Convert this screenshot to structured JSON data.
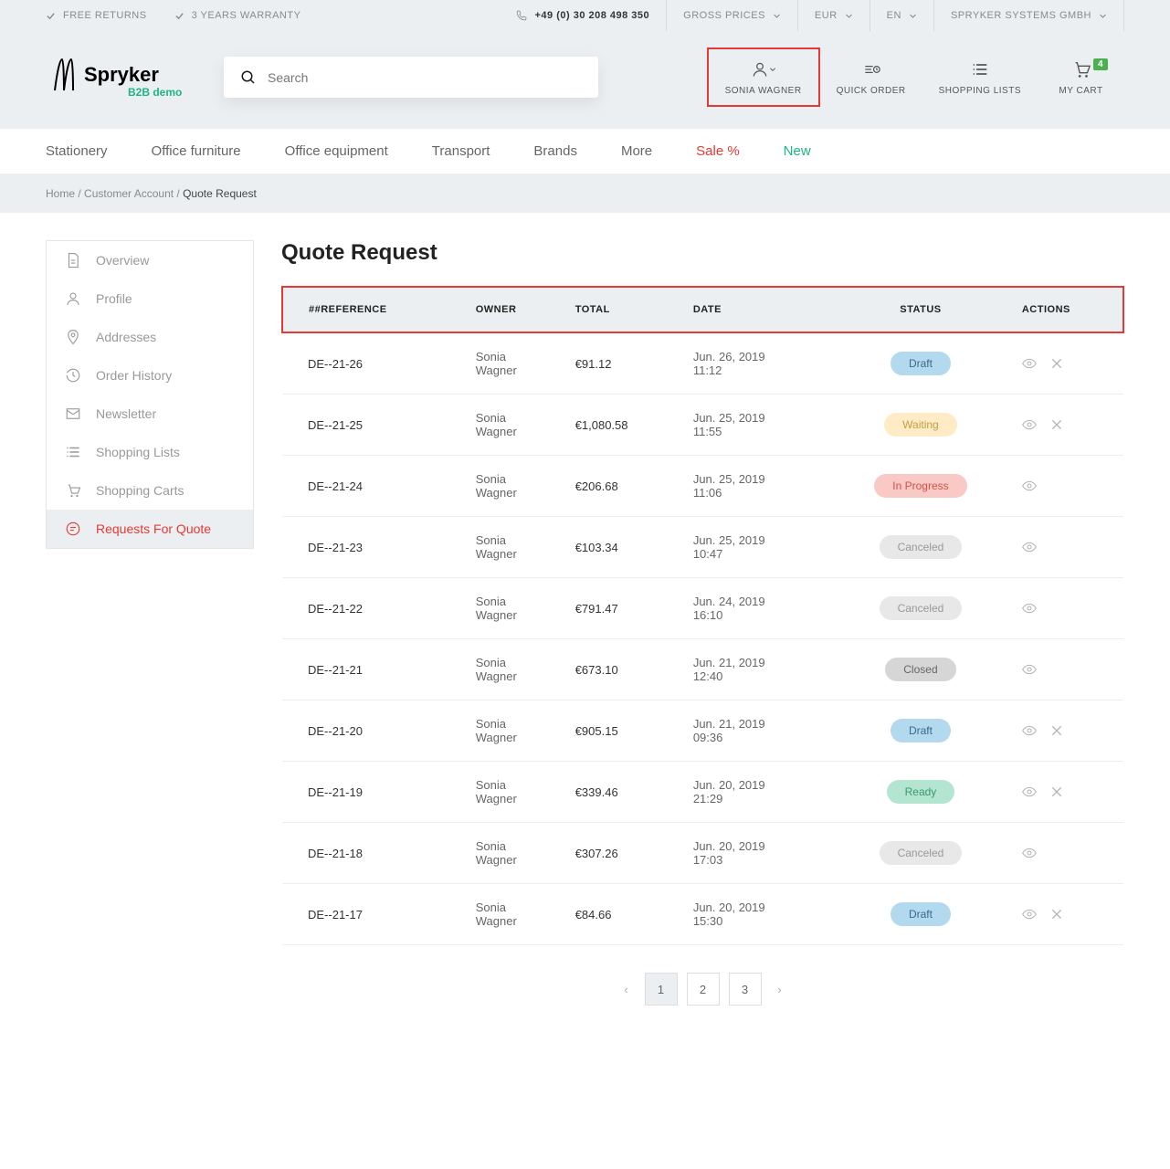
{
  "topbar": {
    "free_returns": "FREE RETURNS",
    "warranty": "3 YEARS WARRANTY",
    "phone": "+49 (0) 30 208 498 350",
    "gross_prices": "GROSS PRICES",
    "currency": "EUR",
    "lang": "EN",
    "company": "SPRYKER SYSTEMS GMBH"
  },
  "search": {
    "placeholder": "Search"
  },
  "header": {
    "user": "SONIA WAGNER",
    "quick_order": "QUICK ORDER",
    "shopping_lists": "SHOPPING LISTS",
    "my_cart": "MY CART",
    "cart_count": "4"
  },
  "nav": {
    "items": [
      {
        "label": "Stationery",
        "class": ""
      },
      {
        "label": "Office furniture",
        "class": ""
      },
      {
        "label": "Office equipment",
        "class": ""
      },
      {
        "label": "Transport",
        "class": ""
      },
      {
        "label": "Brands",
        "class": ""
      },
      {
        "label": "More",
        "class": ""
      },
      {
        "label": "Sale %",
        "class": "sale"
      },
      {
        "label": "New",
        "class": "new"
      }
    ]
  },
  "breadcrumb": {
    "home": "Home",
    "account": "Customer Account",
    "current": "Quote Request"
  },
  "sidebar": {
    "items": [
      {
        "label": "Overview",
        "icon": "doc"
      },
      {
        "label": "Profile",
        "icon": "user"
      },
      {
        "label": "Addresses",
        "icon": "pin"
      },
      {
        "label": "Order History",
        "icon": "history"
      },
      {
        "label": "Newsletter",
        "icon": "mail"
      },
      {
        "label": "Shopping Lists",
        "icon": "list"
      },
      {
        "label": "Shopping Carts",
        "icon": "cart"
      },
      {
        "label": "Requests For Quote",
        "icon": "quote",
        "active": true
      }
    ]
  },
  "page_title": "Quote Request",
  "columns": {
    "ref": "##REFERENCE",
    "owner": "OWNER",
    "total": "TOTAL",
    "date": "DATE",
    "status": "STATUS",
    "actions": "ACTIONS"
  },
  "rows": [
    {
      "ref": "DE--21-26",
      "owner": "Sonia Wagner",
      "total": "€91.12",
      "date": "Jun. 26, 2019 11:12",
      "status": "Draft",
      "status_class": "draft",
      "cancel": true
    },
    {
      "ref": "DE--21-25",
      "owner": "Sonia Wagner",
      "total": "€1,080.58",
      "date": "Jun. 25, 2019 11:55",
      "status": "Waiting",
      "status_class": "waiting",
      "cancel": true
    },
    {
      "ref": "DE--21-24",
      "owner": "Sonia Wagner",
      "total": "€206.68",
      "date": "Jun. 25, 2019 11:06",
      "status": "In Progress",
      "status_class": "inprogress",
      "cancel": false
    },
    {
      "ref": "DE--21-23",
      "owner": "Sonia Wagner",
      "total": "€103.34",
      "date": "Jun. 25, 2019 10:47",
      "status": "Canceled",
      "status_class": "canceled",
      "cancel": false
    },
    {
      "ref": "DE--21-22",
      "owner": "Sonia Wagner",
      "total": "€791.47",
      "date": "Jun. 24, 2019 16:10",
      "status": "Canceled",
      "status_class": "canceled",
      "cancel": false
    },
    {
      "ref": "DE--21-21",
      "owner": "Sonia Wagner",
      "total": "€673.10",
      "date": "Jun. 21, 2019 12:40",
      "status": "Closed",
      "status_class": "closed",
      "cancel": false
    },
    {
      "ref": "DE--21-20",
      "owner": "Sonia Wagner",
      "total": "€905.15",
      "date": "Jun. 21, 2019 09:36",
      "status": "Draft",
      "status_class": "draft",
      "cancel": true
    },
    {
      "ref": "DE--21-19",
      "owner": "Sonia Wagner",
      "total": "€339.46",
      "date": "Jun. 20, 2019 21:29",
      "status": "Ready",
      "status_class": "ready",
      "cancel": true
    },
    {
      "ref": "DE--21-18",
      "owner": "Sonia Wagner",
      "total": "€307.26",
      "date": "Jun. 20, 2019 17:03",
      "status": "Canceled",
      "status_class": "canceled",
      "cancel": false
    },
    {
      "ref": "DE--21-17",
      "owner": "Sonia Wagner",
      "total": "€84.66",
      "date": "Jun. 20, 2019 15:30",
      "status": "Draft",
      "status_class": "draft",
      "cancel": true
    }
  ],
  "pagination": {
    "pages": [
      "1",
      "2",
      "3"
    ],
    "active": "1"
  }
}
